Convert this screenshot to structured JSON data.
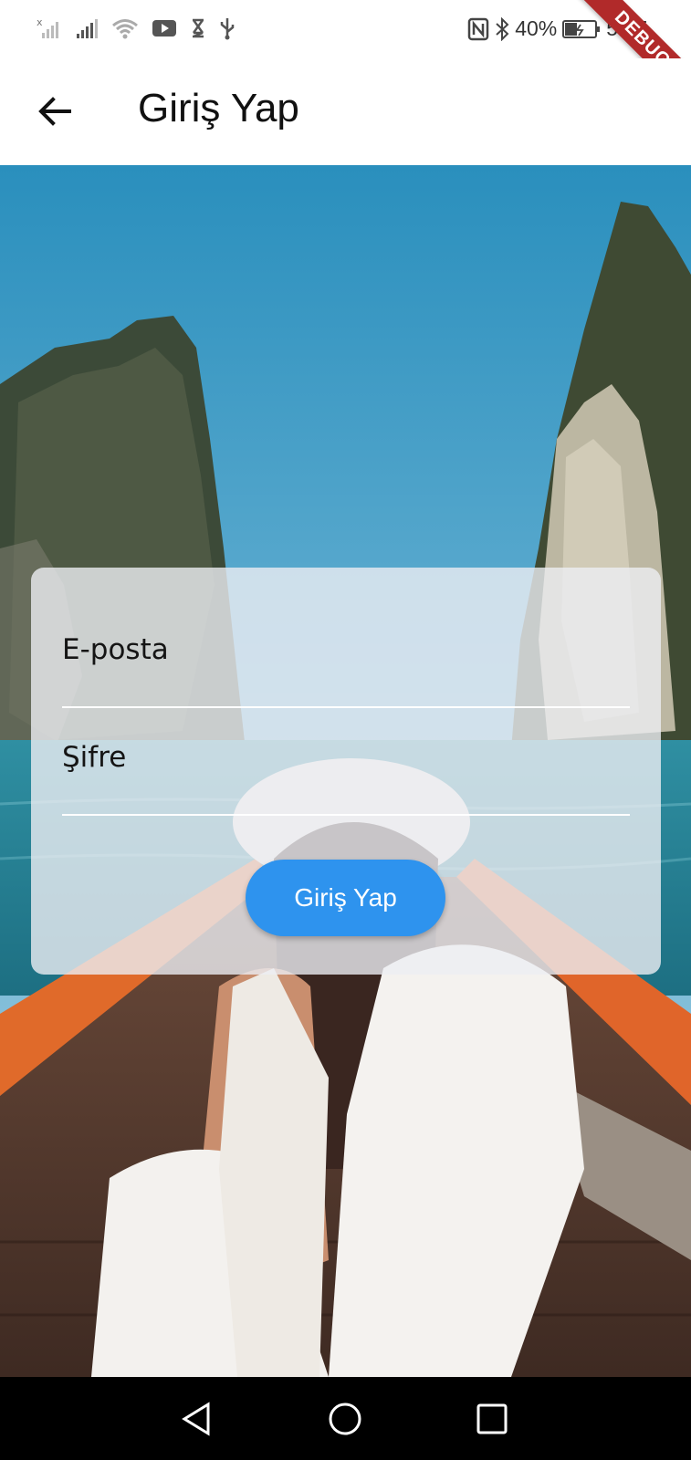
{
  "status_bar": {
    "battery": "40%",
    "time": "5:17",
    "icons": [
      "no-sim-signal-icon",
      "signal-icon",
      "wifi-icon",
      "youtube-icon",
      "hourglass-icon",
      "usb-icon",
      "nfc-icon",
      "bluetooth-icon",
      "battery-charging-icon"
    ],
    "debug_banner": "DEBUG"
  },
  "app_bar": {
    "back_icon": "arrow-left-icon",
    "title": "Giriş Yap"
  },
  "login_form": {
    "email_label": "E-posta",
    "password_label": "Şifre",
    "submit_label": "Giriş Yap",
    "submit_color": "#2e93ee"
  },
  "nav_bar": {
    "icons": [
      "back-triangle-icon",
      "home-circle-icon",
      "recents-square-icon"
    ]
  }
}
